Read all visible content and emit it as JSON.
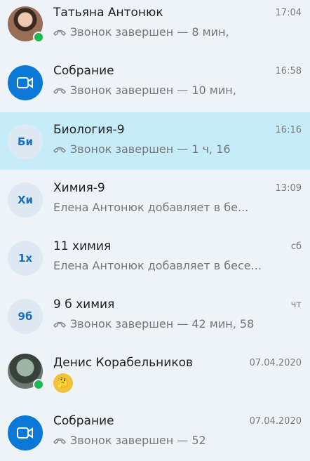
{
  "chats": [
    {
      "name": "Татьяна Антонюк",
      "time": "17:04",
      "preview": "Звонок завершен — 8 мин,",
      "avatar": "photo1",
      "online": true,
      "call": true
    },
    {
      "name": "Собрание",
      "time": "16:58",
      "preview": "Звонок завершен — 10 мин,",
      "avatar": "meeting",
      "call": true
    },
    {
      "name": "Биология-9",
      "time": "16:16",
      "preview": "Звонок завершен — 1 ч, 16",
      "avatar": "initials",
      "initials": "Би",
      "call": true,
      "selected": true
    },
    {
      "name": "Химия-9",
      "time": "13:09",
      "preview": "Елена Антонюк добавляет в бе...",
      "avatar": "initials",
      "initials": "Хи",
      "call": false
    },
    {
      "name": "11 химия",
      "time": "сб",
      "preview": "Елена Антонюк добавляет в бесе...",
      "avatar": "initials",
      "initials": "1х",
      "call": false
    },
    {
      "name": "9 б химия",
      "time": "чт",
      "preview": "Звонок завершен — 42 мин, 58",
      "avatar": "initials",
      "initials": "9б",
      "call": true
    },
    {
      "name": "Денис Корабельников",
      "time": "07.04.2020",
      "preview": "",
      "avatar": "photo2",
      "online": true,
      "emoji": "thinking-emoji-icon"
    },
    {
      "name": "Собрание",
      "time": "07.04.2020",
      "preview": "Звонок завершен — 52",
      "avatar": "meeting",
      "call": true
    }
  ],
  "colors": {
    "accent": "#0a78d7",
    "selected": "#c6ecfa",
    "online": "#1db954"
  }
}
